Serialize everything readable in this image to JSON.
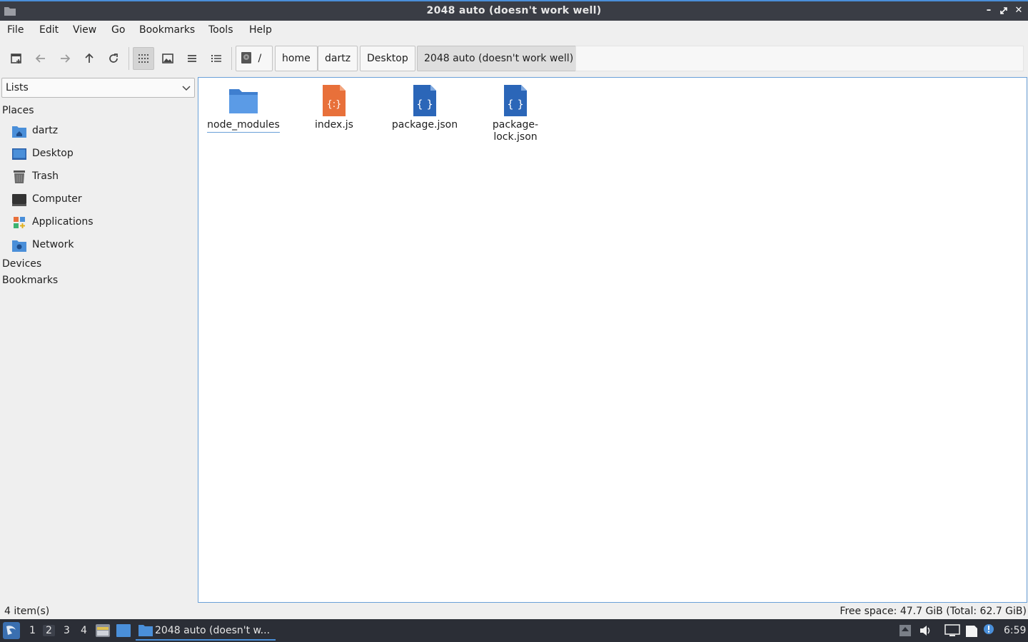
{
  "window": {
    "title": "2048 auto (doesn't work well)",
    "controls": [
      "minimize",
      "maximize",
      "close"
    ]
  },
  "menubar": {
    "items": [
      "File",
      "Edit",
      "View",
      "Go",
      "Bookmarks",
      "Tools",
      "Help"
    ]
  },
  "toolbar": {
    "breadcrumb": [
      "/",
      "home",
      "dartz",
      "Desktop",
      "2048 auto (doesn't work well)"
    ]
  },
  "sidebar": {
    "dropdown_value": "Lists",
    "places_heading": "Places",
    "places": [
      {
        "label": "dartz",
        "icon": "home-folder-icon"
      },
      {
        "label": "Desktop",
        "icon": "desktop-icon"
      },
      {
        "label": "Trash",
        "icon": "trash-icon"
      },
      {
        "label": "Computer",
        "icon": "computer-icon"
      },
      {
        "label": "Applications",
        "icon": "applications-icon"
      },
      {
        "label": "Network",
        "icon": "network-icon"
      }
    ],
    "devices_heading": "Devices",
    "bookmarks_heading": "Bookmarks"
  },
  "files": [
    {
      "name": "node_modules",
      "type": "folder"
    },
    {
      "name": "index.js",
      "type": "javascript"
    },
    {
      "name": "package.json",
      "type": "json"
    },
    {
      "name_line1": "package-",
      "name_line2": "lock.json",
      "type": "json"
    }
  ],
  "statusbar": {
    "count": "4 item(s)",
    "free_space": "Free space: 47.7 GiB (Total: 62.7 GiB)"
  },
  "taskbar": {
    "workspaces": [
      "1",
      "2",
      "3",
      "4"
    ],
    "active_workspace": "2",
    "task_label": "2048 auto (doesn't w...",
    "clock": "6:59"
  },
  "colors": {
    "accent": "#4a8fd9",
    "folder": "#4a8fd9",
    "js_file": "#e8703a",
    "json_file": "#2f6fc4",
    "taskbar_bg": "#2b2e36",
    "titlebar_bg": "#3a3d45"
  }
}
